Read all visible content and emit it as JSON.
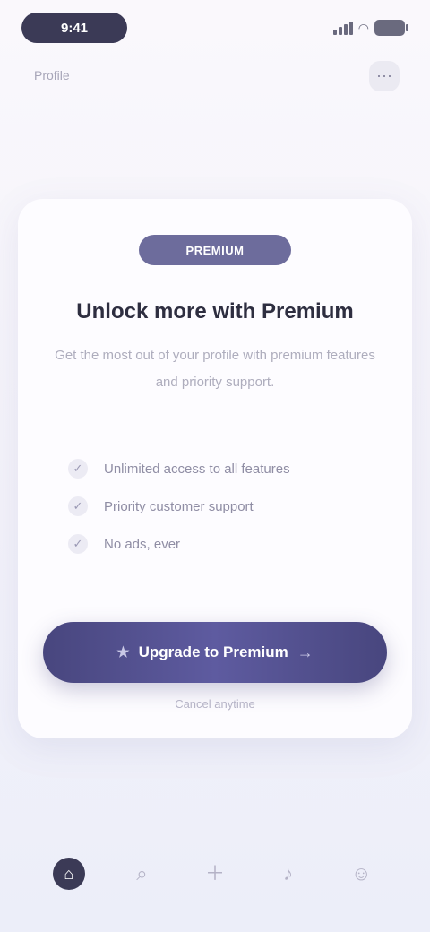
{
  "status_bar": {
    "time": "9:41",
    "icons": [
      "signal-icon",
      "wifi-icon",
      "battery-icon"
    ]
  },
  "header": {
    "title": "Profile",
    "menu_icon": "menu-icon"
  },
  "card": {
    "badge": "PREMIUM",
    "title": "Unlock more with Premium",
    "description": "Get the most out of your profile with premium features and priority support.",
    "features": [
      {
        "label": "Unlimited access to all features",
        "icon": "check-icon"
      },
      {
        "label": "Priority customer support",
        "icon": "check-icon"
      },
      {
        "label": "No ads, ever",
        "icon": "check-icon"
      }
    ],
    "cta": {
      "label": "Upgrade to Premium",
      "left_icon": "star-icon",
      "right_icon": "arrow-right-icon"
    },
    "cta_sub": "Cancel anytime"
  },
  "bottom_nav": {
    "items": [
      {
        "label": "",
        "icon": "home-icon",
        "active": true
      },
      {
        "label": "",
        "icon": "search-icon",
        "active": false
      },
      {
        "label": "",
        "icon": "add-icon",
        "active": false
      },
      {
        "label": "",
        "icon": "bell-icon",
        "active": false
      },
      {
        "label": "",
        "icon": "user-icon",
        "active": false
      }
    ]
  },
  "colors": {
    "accent": "#4b4982",
    "badge": "#6d6c9c",
    "background": "#f3f2fa",
    "card": "#fdfcff"
  }
}
